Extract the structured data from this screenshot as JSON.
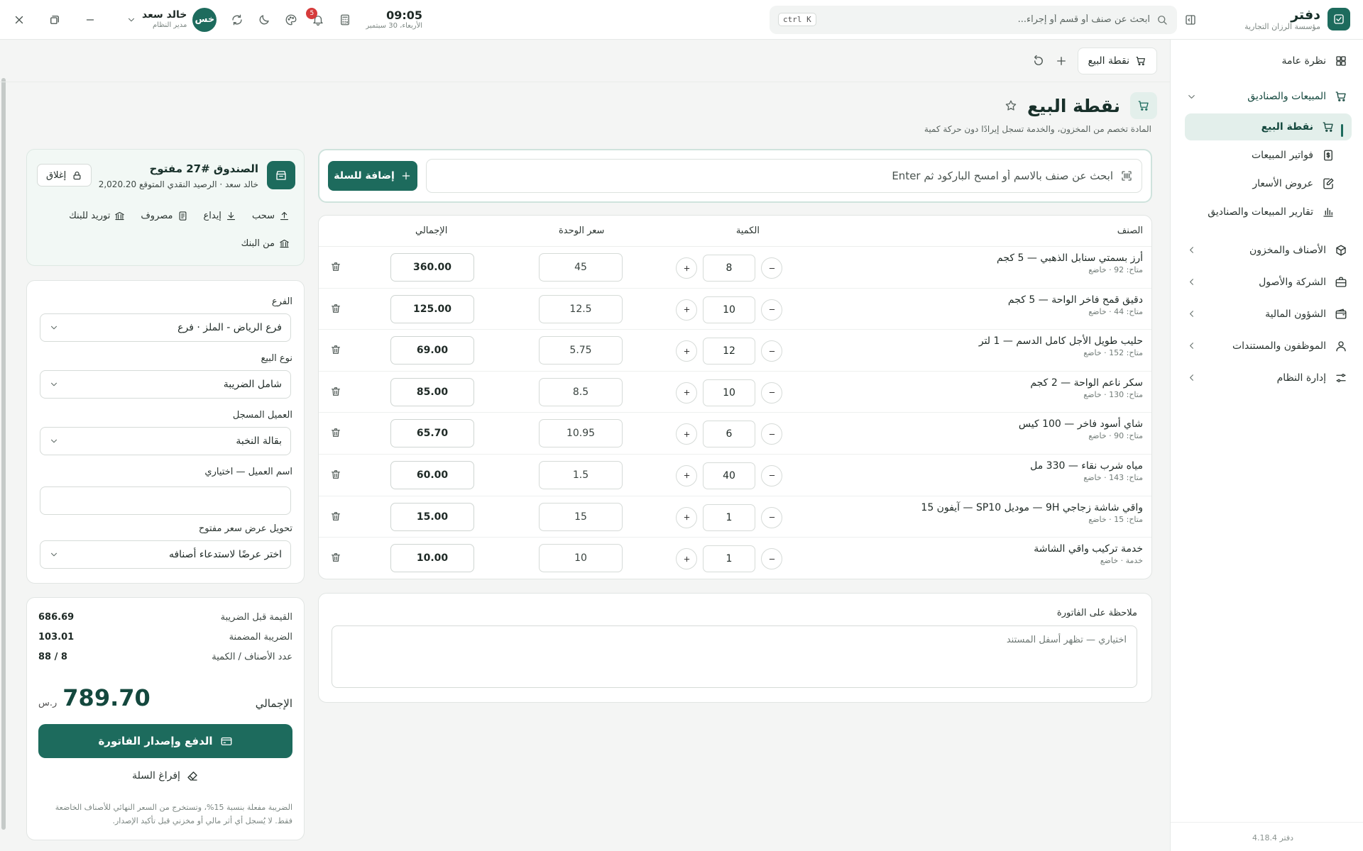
{
  "brand": {
    "name": "دفتر",
    "org": "مؤسسة الرزان التجارية"
  },
  "search": {
    "placeholder": "ابحث عن صنف أو قسم أو إجراء...",
    "shortcut": "ctrl K"
  },
  "clock": {
    "time": "09:05",
    "date": "الأربعاء، 30 سبتمبر"
  },
  "notifications": {
    "count": "5"
  },
  "user": {
    "initials": "خس",
    "name": "خالد سعد",
    "role": "مدير النظام"
  },
  "sidebar": {
    "overview": "نظرة عامة",
    "sales_group": "المبيعات والصناديق",
    "sales_items": [
      "نقطة البيع",
      "فواتير المبيعات",
      "عروض الأسعار",
      "تقارير المبيعات والصناديق"
    ],
    "groups": [
      "الأصناف والمخزون",
      "الشركة والأصول",
      "الشؤون المالية",
      "الموظفون والمستندات",
      "إدارة النظام"
    ],
    "version": "دفتر 4.18.4"
  },
  "tab": {
    "label": "نقطة البيع"
  },
  "page": {
    "title": "نقطة البيع",
    "subtitle": "المادة تخصم من المخزون، والخدمة تسجل إيرادًا دون حركة كمية"
  },
  "barcode": {
    "placeholder": "ابحث عن صنف بالاسم أو امسح الباركود ثم Enter",
    "add_label": "إضافة للسلة"
  },
  "table": {
    "headers": {
      "item": "الصنف",
      "qty": "الكمية",
      "unit_price": "سعر الوحدة",
      "total": "الإجمالي"
    },
    "rows": [
      {
        "name": "أرز بسمتي سنابل الذهبي — 5 كجم",
        "meta": "متاح: 92 · خاضع",
        "qty": "8",
        "price": "45",
        "total": "360.00"
      },
      {
        "name": "دقيق قمح فاخر الواحة — 5 كجم",
        "meta": "متاح: 44 · خاضع",
        "qty": "10",
        "price": "12.5",
        "total": "125.00"
      },
      {
        "name": "حليب طويل الأجل كامل الدسم — 1 لتر",
        "meta": "متاح: 152 · خاضع",
        "qty": "12",
        "price": "5.75",
        "total": "69.00"
      },
      {
        "name": "سكر ناعم الواحة — 2 كجم",
        "meta": "متاح: 130 · خاضع",
        "qty": "10",
        "price": "8.5",
        "total": "85.00"
      },
      {
        "name": "شاي أسود فاخر — 100 كيس",
        "meta": "متاح: 90 · خاضع",
        "qty": "6",
        "price": "10.95",
        "total": "65.70"
      },
      {
        "name": "مياه شرب نقاء — 330 مل",
        "meta": "متاح: 143 · خاضع",
        "qty": "40",
        "price": "1.5",
        "total": "60.00"
      },
      {
        "name": "واقي شاشة زجاجي 9H — موديل SP10 — آيفون 15",
        "meta": "متاح: 15 · خاضع",
        "qty": "1",
        "price": "15",
        "total": "15.00"
      },
      {
        "name": "خدمة تركيب واقي الشاشة",
        "meta": "خدمة · خاضع",
        "qty": "1",
        "price": "10",
        "total": "10.00"
      }
    ]
  },
  "note": {
    "label": "ملاحظة على الفاتورة",
    "placeholder": "اختياري — تظهر أسفل المستند"
  },
  "cashbox": {
    "title": "الصندوق #27 مفتوح",
    "subtitle": "خالد سعد · الرصيد النقدي المتوقع 2,020.20",
    "close_label": "إغلاق",
    "actions": [
      "سحب",
      "إيداع",
      "مصروف",
      "توريد للبنك",
      "من البنك"
    ]
  },
  "form": {
    "branch_label": "الفرع",
    "branch_value": "فرع الرياض - الملز · فرع",
    "sale_type_label": "نوع البيع",
    "sale_type_value": "شامل الضريبة",
    "customer_label": "العميل المسجل",
    "customer_value": "بقالة النخبة",
    "customer_name_label": "اسم العميل — اختياري",
    "quote_label": "تحويل عرض سعر مفتوح",
    "quote_value": "اختر عرضًا لاستدعاء أصنافه"
  },
  "summary": {
    "pre_tax_label": "القيمة قبل الضريبة",
    "pre_tax_value": "686.69",
    "tax_label": "الضريبة المضمنة",
    "tax_value": "103.01",
    "count_label": "عدد الأصناف / الكمية",
    "count_value": "88 / 8",
    "grand_label": "الإجمالي",
    "grand_value": "789.70",
    "currency": "ر.س",
    "pay_label": "الدفع وإصدار الفاتورة",
    "empty_label": "إفراغ السلة",
    "tax_note": "الضريبة مفعلة بنسبة 15%، وتستخرج من السعر النهائي للأصناف الخاضعة فقط. لا يُسجل أي أثر مالي أو مخزني قبل تأكيد الإصدار."
  }
}
